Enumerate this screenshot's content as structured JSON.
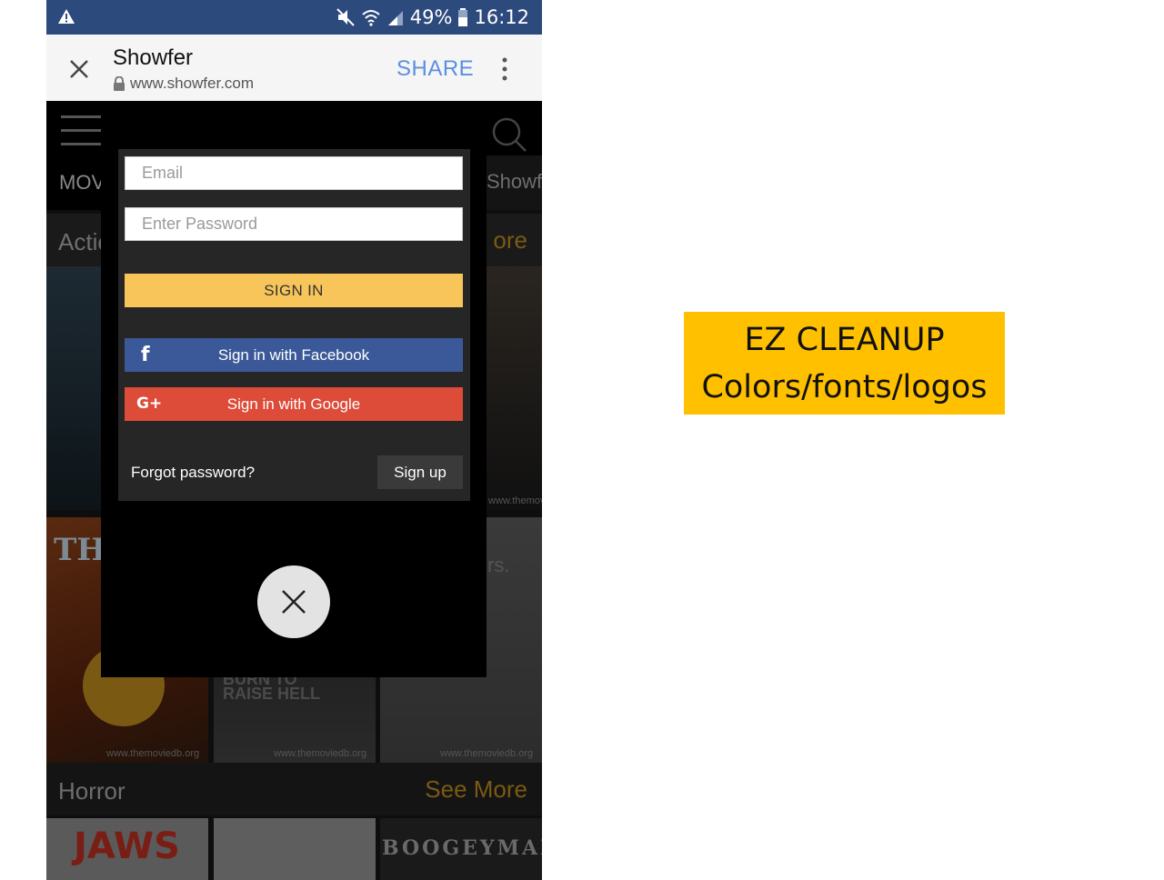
{
  "status_bar": {
    "battery": "49%",
    "time": "16:12"
  },
  "browser": {
    "title": "Showfer",
    "url": "www.showfer.com",
    "share_label": "SHARE"
  },
  "site": {
    "tab_movies": "MOV",
    "tab_showfer": "Showf",
    "rows": [
      {
        "label": "Actio",
        "see_more": "ore"
      },
      {
        "label": "Horror",
        "see_more": "See More"
      }
    ],
    "poster_texts": [
      "THE I",
      "BURN TO RAISE HELL",
      "JAWS",
      "BOOGEYMAN",
      "rs."
    ],
    "watermark": "www.themoviedb.org"
  },
  "login": {
    "email_placeholder": "Email",
    "password_placeholder": "Enter Password",
    "signin_label": "SIGN IN",
    "facebook_label": "Sign in with Facebook",
    "facebook_icon": "f",
    "google_label": "Sign in with Google",
    "google_icon": "G+",
    "forgot_label": "Forgot password?",
    "signup_label": "Sign up"
  },
  "annotation": {
    "line1": "EZ CLEANUP",
    "line2": "Colors/fonts/logos"
  },
  "colors": {
    "status_bar": "#2d4a7c",
    "signin": "#f7c55a",
    "facebook": "#3b5998",
    "google": "#dd4b39",
    "note": "#ffc000"
  }
}
